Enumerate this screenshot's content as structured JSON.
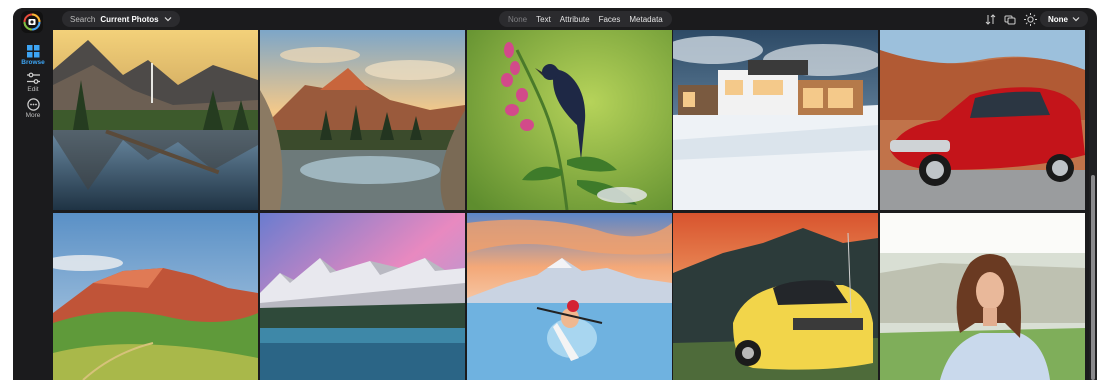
{
  "rail": {
    "items": [
      {
        "label": "Browse",
        "icon": "grid-icon"
      },
      {
        "label": "Edit",
        "icon": "sliders-icon"
      },
      {
        "label": "More",
        "icon": "more-icon"
      }
    ]
  },
  "topbar": {
    "search_label": "Search",
    "search_scope": "Current Photos",
    "filters": [
      "None",
      "Text",
      "Attribute",
      "Faces",
      "Metadata"
    ],
    "sort_label": "None"
  },
  "photos": [
    {
      "subject": "yosemite-valley-reflection"
    },
    {
      "subject": "mountain-lake-sunset"
    },
    {
      "subject": "black-bird-on-flower"
    },
    {
      "subject": "modern-house-in-snow"
    },
    {
      "subject": "red-classic-car"
    },
    {
      "subject": "red-mountain-meadow"
    },
    {
      "subject": "dolomites-lake-pink-sky"
    },
    {
      "subject": "kayaker-mountain-lake"
    },
    {
      "subject": "yellow-sports-car"
    },
    {
      "subject": "woman-portrait"
    }
  ],
  "colors": {
    "accent": "#3da5f5",
    "app_bg": "#1b1b1d",
    "pill_bg": "#2b2b2e"
  }
}
